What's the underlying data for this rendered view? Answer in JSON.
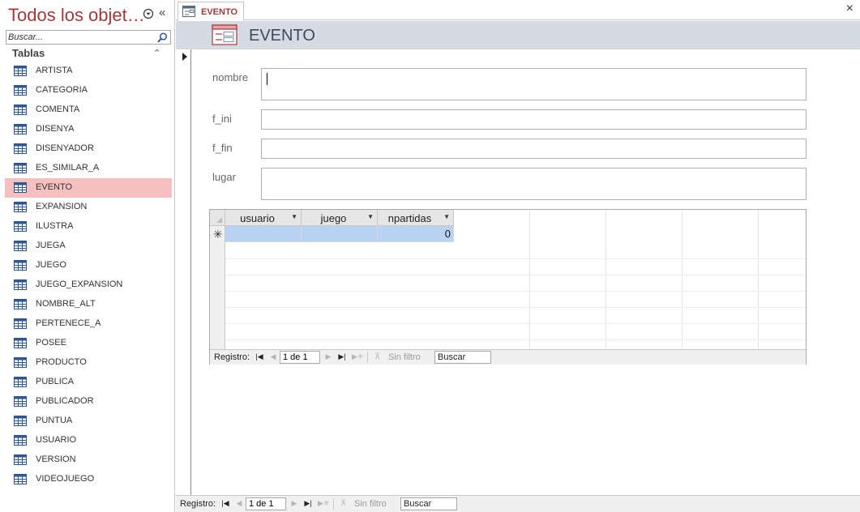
{
  "nav": {
    "title": "Todos los objet…",
    "search_placeholder": "Buscar...",
    "group_label": "Tablas",
    "items": [
      {
        "label": "ARTISTA"
      },
      {
        "label": "CATEGORIA"
      },
      {
        "label": "COMENTA"
      },
      {
        "label": "DISENYA"
      },
      {
        "label": "DISENYADOR"
      },
      {
        "label": "ES_SIMILAR_A"
      },
      {
        "label": "EVENTO",
        "selected": true
      },
      {
        "label": "EXPANSION"
      },
      {
        "label": "ILUSTRA"
      },
      {
        "label": "JUEGA"
      },
      {
        "label": "JUEGO"
      },
      {
        "label": "JUEGO_EXPANSION"
      },
      {
        "label": "NOMBRE_ALT"
      },
      {
        "label": "PERTENECE_A"
      },
      {
        "label": "POSEE"
      },
      {
        "label": "PRODUCTO"
      },
      {
        "label": "PUBLICA"
      },
      {
        "label": "PUBLICADOR"
      },
      {
        "label": "PUNTUA"
      },
      {
        "label": "USUARIO"
      },
      {
        "label": "VERSION"
      },
      {
        "label": "VIDEOJUEGO"
      }
    ]
  },
  "tab": {
    "label": "EVENTO",
    "close_glyph": "×"
  },
  "form": {
    "title": "EVENTO",
    "fields": [
      {
        "label": "nombre",
        "value": ""
      },
      {
        "label": "f_ini",
        "value": ""
      },
      {
        "label": "f_fin",
        "value": ""
      },
      {
        "label": "lugar",
        "value": ""
      }
    ]
  },
  "subform": {
    "columns": [
      "usuario",
      "juego",
      "npartidas"
    ],
    "new_row": {
      "usuario": "",
      "juego": "",
      "npartidas": "0"
    },
    "new_row_marker": "✳",
    "navbar": {
      "label": "Registro:",
      "record": "1 de 1",
      "filter": "Sin filtro",
      "search": "Buscar"
    }
  },
  "main_navbar": {
    "label": "Registro:",
    "record": "1 de 1",
    "filter": "Sin filtro",
    "search": "Buscar"
  },
  "colors": {
    "accent": "#a4373a",
    "selected_item": "#f7c0c0",
    "form_header": "#d5dbe3",
    "new_row": "#b8d4f2"
  }
}
